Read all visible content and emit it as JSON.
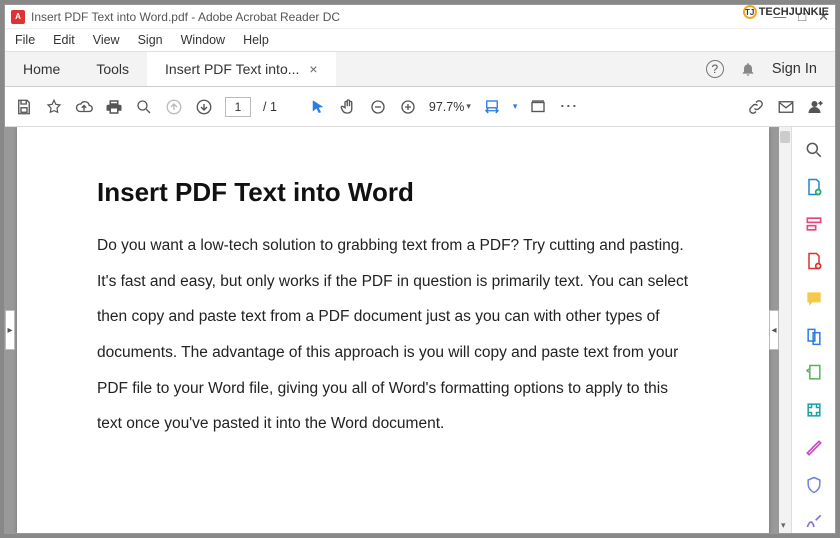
{
  "brand": {
    "name": "TECHJUNKIE"
  },
  "titlebar": {
    "text": "Insert PDF Text into Word.pdf - Adobe Acrobat Reader DC"
  },
  "menubar": [
    "File",
    "Edit",
    "View",
    "Sign",
    "Window",
    "Help"
  ],
  "tabs": {
    "home": "Home",
    "tools": "Tools",
    "active": "Insert PDF Text into...",
    "signin": "Sign In"
  },
  "toolbar": {
    "page_current": "1",
    "page_total": "/  1",
    "zoom": "97.7%"
  },
  "document": {
    "title": "Insert PDF Text into Word",
    "body": "Do you want a low-tech solution to grabbing text from a PDF? Try cutting and pasting. It's fast and easy, but only works if the PDF in question is primarily text. You can select then copy and paste text from a PDF document just as you can with other types of documents. The advantage of this approach is you will copy and paste text from your PDF file to your Word file, giving you all of Word's formatting options to apply to this text once you've pasted it into the Word document."
  }
}
